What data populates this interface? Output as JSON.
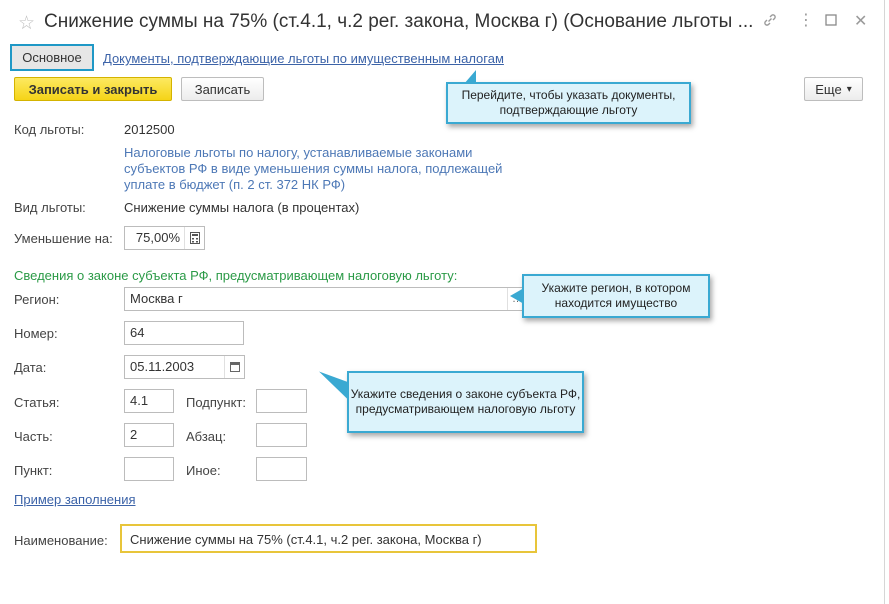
{
  "window": {
    "title": "Снижение суммы на 75% (ст.4.1, ч.2 рег. закона, Москва г) (Основание льготы ...",
    "icons": [
      "star-icon",
      "link-icon",
      "more-icon",
      "maximize-icon",
      "close-icon"
    ]
  },
  "tabs": {
    "main": "Основное",
    "documents": "Документы, подтверждающие льготы по имущественным налогам"
  },
  "toolbar": {
    "save_close": "Записать и закрыть",
    "save": "Записать",
    "more": "Еще",
    "more_arrow": "▾"
  },
  "form": {
    "code_label": "Код льготы:",
    "code_value": "2012500",
    "code_description": "Налоговые льготы по налогу, устанавливаемые законами субъектов РФ в виде уменьшения суммы налога, подлежащей уплате в бюджет (п. 2 ст. 372 НК РФ)",
    "type_label": "Вид льготы:",
    "type_value": "Снижение суммы налога (в процентах)",
    "reduction_label": "Уменьшение на:",
    "reduction_value": "75,00%",
    "law_section_title": "Сведения о законе субъекта РФ, предусматривающем налоговую льготу:",
    "region_label": "Регион:",
    "region_value": "Москва г",
    "number_label": "Номер:",
    "number_value": "64",
    "date_label": "Дата:",
    "date_value": "05.11.2003",
    "article_label": "Статья:",
    "article_value": "4.1",
    "subpoint_label": "Подпункт:",
    "subpoint_value": "",
    "part_label": "Часть:",
    "part_value": "2",
    "paragraph_label": "Абзац:",
    "paragraph_value": "",
    "point_label": "Пункт:",
    "point_value": "",
    "other_label": "Иное:",
    "other_value": "",
    "example_link": "Пример заполнения",
    "name_label": "Наименование:",
    "name_value": "Снижение суммы на 75% (ст.4.1, ч.2 рег. закона, Москва г)"
  },
  "callouts": {
    "documents_hint": "Перейдите, чтобы указать документы, подтверждающие льготу",
    "region_hint": "Укажите регион, в котором находится имущество",
    "law_hint": "Укажите сведения о законе субъекта РФ, предусматривающем налоговую льготу"
  },
  "colors": {
    "accent_border": "#1f98c6",
    "primary_button": "#f5d417",
    "section_title": "#2a9a46",
    "link": "#3c63a8",
    "callout_bg": "#dcf3fb",
    "name_field_border": "#e8c53a"
  }
}
